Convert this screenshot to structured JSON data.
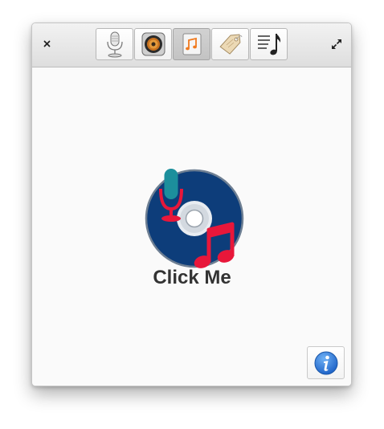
{
  "window": {
    "close_icon": "close-icon",
    "fullscreen_icon": "fullscreen-icon"
  },
  "toolbar": {
    "items": [
      {
        "id": "microphone",
        "icon": "microphone-icon",
        "active": false
      },
      {
        "id": "speaker",
        "icon": "speaker-icon",
        "active": false
      },
      {
        "id": "music",
        "icon": "music-note-icon",
        "active": true
      },
      {
        "id": "tag",
        "icon": "tag-icon",
        "active": false
      },
      {
        "id": "playlist",
        "icon": "playlist-icon",
        "active": false
      }
    ]
  },
  "main": {
    "button_label": "Click Me",
    "icon": "disc-microphone-music-icon"
  },
  "info": {
    "icon": "info-icon"
  },
  "colors": {
    "disc_blue": "#0d3d7a",
    "accent_red": "#e8173a",
    "teal": "#1c8f9c",
    "info_blue": "#2a7de1"
  }
}
